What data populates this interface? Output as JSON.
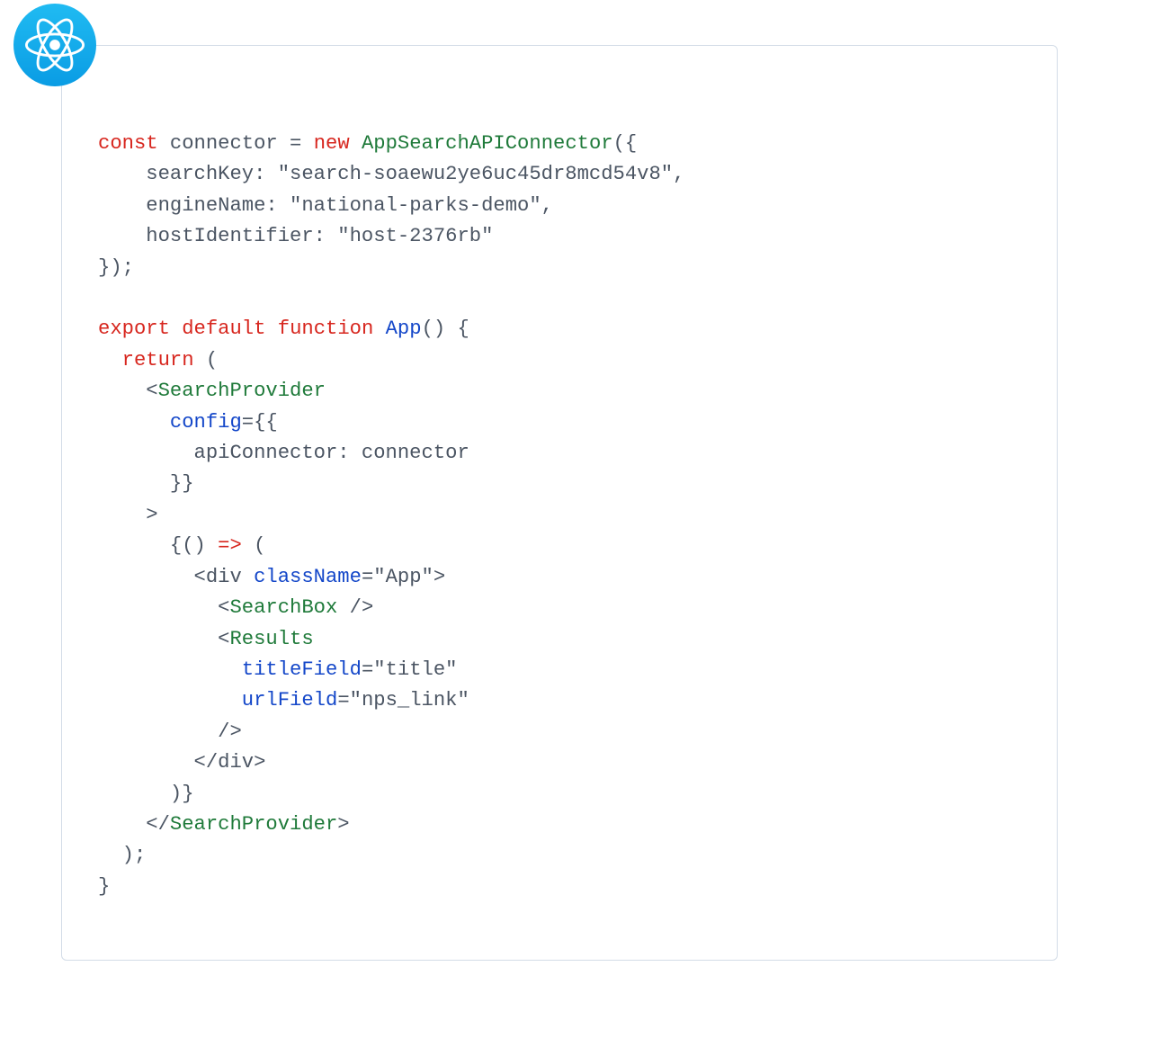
{
  "code": {
    "tokens": [
      {
        "cls": "tok-kw",
        "t": "const"
      },
      {
        "cls": "tok-plain",
        "t": " connector "
      },
      {
        "cls": "tok-pn",
        "t": "= "
      },
      {
        "cls": "tok-kw",
        "t": "new"
      },
      {
        "cls": "tok-plain",
        "t": " "
      },
      {
        "cls": "tok-fn",
        "t": "AppSearchAPIConnector"
      },
      {
        "cls": "tok-pn",
        "t": "({"
      },
      {
        "cls": "nl",
        "t": "\n"
      },
      {
        "cls": "tok-plain",
        "t": "    searchKey: "
      },
      {
        "cls": "tok-str",
        "t": "\"search-soaewu2ye6uc45dr8mcd54v8\""
      },
      {
        "cls": "tok-pn",
        "t": ","
      },
      {
        "cls": "nl",
        "t": "\n"
      },
      {
        "cls": "tok-plain",
        "t": "    engineName: "
      },
      {
        "cls": "tok-str",
        "t": "\"national-parks-demo\""
      },
      {
        "cls": "tok-pn",
        "t": ","
      },
      {
        "cls": "nl",
        "t": "\n"
      },
      {
        "cls": "tok-plain",
        "t": "    hostIdentifier: "
      },
      {
        "cls": "tok-str",
        "t": "\"host-2376rb\""
      },
      {
        "cls": "nl",
        "t": "\n"
      },
      {
        "cls": "tok-pn",
        "t": "});"
      },
      {
        "cls": "nl",
        "t": "\n"
      },
      {
        "cls": "nl",
        "t": "\n"
      },
      {
        "cls": "tok-kw",
        "t": "export"
      },
      {
        "cls": "tok-plain",
        "t": " "
      },
      {
        "cls": "tok-kw",
        "t": "default"
      },
      {
        "cls": "tok-plain",
        "t": " "
      },
      {
        "cls": "tok-kw",
        "t": "function"
      },
      {
        "cls": "tok-plain",
        "t": " "
      },
      {
        "cls": "tok-attr",
        "t": "App"
      },
      {
        "cls": "tok-pn",
        "t": "() {"
      },
      {
        "cls": "nl",
        "t": "\n"
      },
      {
        "cls": "tok-plain",
        "t": "  "
      },
      {
        "cls": "tok-kw",
        "t": "return"
      },
      {
        "cls": "tok-plain",
        "t": " ("
      },
      {
        "cls": "nl",
        "t": "\n"
      },
      {
        "cls": "tok-plain",
        "t": "    <"
      },
      {
        "cls": "tok-fn",
        "t": "SearchProvider"
      },
      {
        "cls": "nl",
        "t": "\n"
      },
      {
        "cls": "tok-plain",
        "t": "      "
      },
      {
        "cls": "tok-attr",
        "t": "config"
      },
      {
        "cls": "tok-pn",
        "t": "={{"
      },
      {
        "cls": "nl",
        "t": "\n"
      },
      {
        "cls": "tok-plain",
        "t": "        apiConnector: connector"
      },
      {
        "cls": "nl",
        "t": "\n"
      },
      {
        "cls": "tok-plain",
        "t": "      "
      },
      {
        "cls": "tok-pn",
        "t": "}}"
      },
      {
        "cls": "nl",
        "t": "\n"
      },
      {
        "cls": "tok-plain",
        "t": "    >"
      },
      {
        "cls": "nl",
        "t": "\n"
      },
      {
        "cls": "tok-plain",
        "t": "      {() "
      },
      {
        "cls": "tok-kw",
        "t": "=>"
      },
      {
        "cls": "tok-plain",
        "t": " ("
      },
      {
        "cls": "nl",
        "t": "\n"
      },
      {
        "cls": "tok-plain",
        "t": "        <div "
      },
      {
        "cls": "tok-attr",
        "t": "className"
      },
      {
        "cls": "tok-pn",
        "t": "="
      },
      {
        "cls": "tok-str",
        "t": "\"App\""
      },
      {
        "cls": "tok-plain",
        "t": ">"
      },
      {
        "cls": "nl",
        "t": "\n"
      },
      {
        "cls": "tok-plain",
        "t": "          <"
      },
      {
        "cls": "tok-fn",
        "t": "SearchBox"
      },
      {
        "cls": "tok-plain",
        "t": " />"
      },
      {
        "cls": "nl",
        "t": "\n"
      },
      {
        "cls": "tok-plain",
        "t": "          <"
      },
      {
        "cls": "tok-fn",
        "t": "Results"
      },
      {
        "cls": "nl",
        "t": "\n"
      },
      {
        "cls": "tok-plain",
        "t": "            "
      },
      {
        "cls": "tok-attr",
        "t": "titleField"
      },
      {
        "cls": "tok-pn",
        "t": "="
      },
      {
        "cls": "tok-str",
        "t": "\"title\""
      },
      {
        "cls": "nl",
        "t": "\n"
      },
      {
        "cls": "tok-plain",
        "t": "            "
      },
      {
        "cls": "tok-attr",
        "t": "urlField"
      },
      {
        "cls": "tok-pn",
        "t": "="
      },
      {
        "cls": "tok-str",
        "t": "\"nps_link\""
      },
      {
        "cls": "nl",
        "t": "\n"
      },
      {
        "cls": "tok-plain",
        "t": "          />"
      },
      {
        "cls": "nl",
        "t": "\n"
      },
      {
        "cls": "tok-plain",
        "t": "        </div>"
      },
      {
        "cls": "nl",
        "t": "\n"
      },
      {
        "cls": "tok-plain",
        "t": "      )}"
      },
      {
        "cls": "nl",
        "t": "\n"
      },
      {
        "cls": "tok-plain",
        "t": "    </"
      },
      {
        "cls": "tok-fn",
        "t": "SearchProvider"
      },
      {
        "cls": "tok-plain",
        "t": ">"
      },
      {
        "cls": "nl",
        "t": "\n"
      },
      {
        "cls": "tok-plain",
        "t": "  );"
      },
      {
        "cls": "nl",
        "t": "\n"
      },
      {
        "cls": "tok-plain",
        "t": "}"
      }
    ]
  }
}
